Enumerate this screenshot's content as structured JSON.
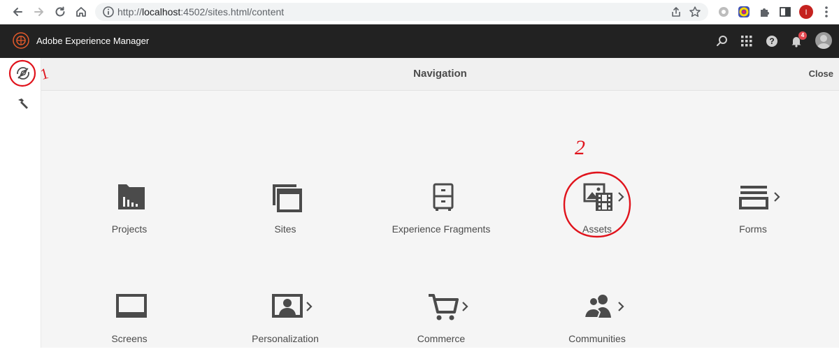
{
  "browser": {
    "url_scheme": "http://",
    "url_host": "localhost",
    "url_rest": ":4502/sites.html/content",
    "profile_initial": "I"
  },
  "header": {
    "title": "Adobe Experience Manager",
    "notification_count": "4"
  },
  "nav": {
    "title": "Navigation",
    "close_label": "Close",
    "tiles": [
      {
        "label": "Projects"
      },
      {
        "label": "Sites"
      },
      {
        "label": "Experience Fragments"
      },
      {
        "label": "Assets"
      },
      {
        "label": "Forms"
      },
      {
        "label": "Screens"
      },
      {
        "label": "Personalization"
      },
      {
        "label": "Commerce"
      },
      {
        "label": "Communities"
      }
    ]
  },
  "annotations": {
    "mark_1": "1",
    "mark_2": "2",
    "color": "#e0131c"
  },
  "colors": {
    "header_bg": "#222222",
    "panel_bg": "#f5f5f5",
    "icon_gray": "#4b4b4b"
  }
}
